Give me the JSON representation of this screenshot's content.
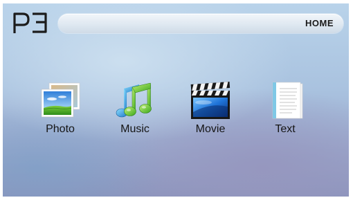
{
  "brand": {
    "logo_text": "P3"
  },
  "header": {
    "title": "HOME"
  },
  "menu": {
    "items": [
      {
        "label": "Photo",
        "icon": "photo-icon"
      },
      {
        "label": "Music",
        "icon": "music-note-icon"
      },
      {
        "label": "Movie",
        "icon": "clapperboard-icon"
      },
      {
        "label": "Text",
        "icon": "document-icon"
      }
    ]
  },
  "colors": {
    "background_top": "#b9d3ea",
    "background_bottom": "#8d95bd",
    "title_bar": "#e4ecf3",
    "label_text": "#151515"
  }
}
